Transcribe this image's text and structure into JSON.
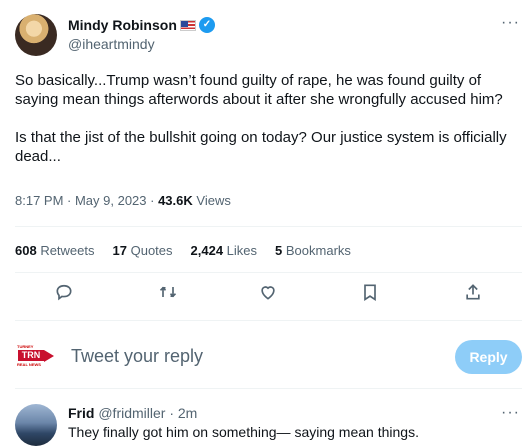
{
  "tweet": {
    "author_name": "Mindy Robinson",
    "author_handle": "@iheartmindy",
    "more_label": "···",
    "body": [
      "So basically...Trump wasn’t found guilty of rape, he was found guilty of saying mean things afterwords about it after she wrongfully accused him?",
      "Is that the jist of the bullshit going on today? Our justice system is officially dead..."
    ],
    "time": "8:17 PM · May 9, 2023 · ",
    "views_count": "43.6K",
    "views_label": " Views"
  },
  "stats": {
    "retweets_count": "608",
    "retweets_label": " Retweets",
    "quotes_count": "17",
    "quotes_label": " Quotes",
    "likes_count": "2,424",
    "likes_label": " Likes",
    "bookmarks_count": "5",
    "bookmarks_label": " Bookmarks"
  },
  "actions": {
    "icons": [
      "reply-icon",
      "retweet-icon",
      "like-icon",
      "bookmark-icon",
      "share-icon"
    ]
  },
  "reply_box": {
    "logo_top": "TURNEY",
    "logo_mid": "TRN",
    "logo_bottom": "REAL NEWS",
    "placeholder": "Tweet your reply",
    "button_label": "Reply"
  },
  "reply": {
    "name": "Frid",
    "meta": " @fridmiller · 2m",
    "text": "They finally got him on something— saying mean things.",
    "more_label": "···"
  },
  "colors": {
    "accent": "#1d9bf0",
    "reply_button": "#8ecdf8",
    "logo_red": "#c8102e",
    "secondary_text": "#536471"
  }
}
